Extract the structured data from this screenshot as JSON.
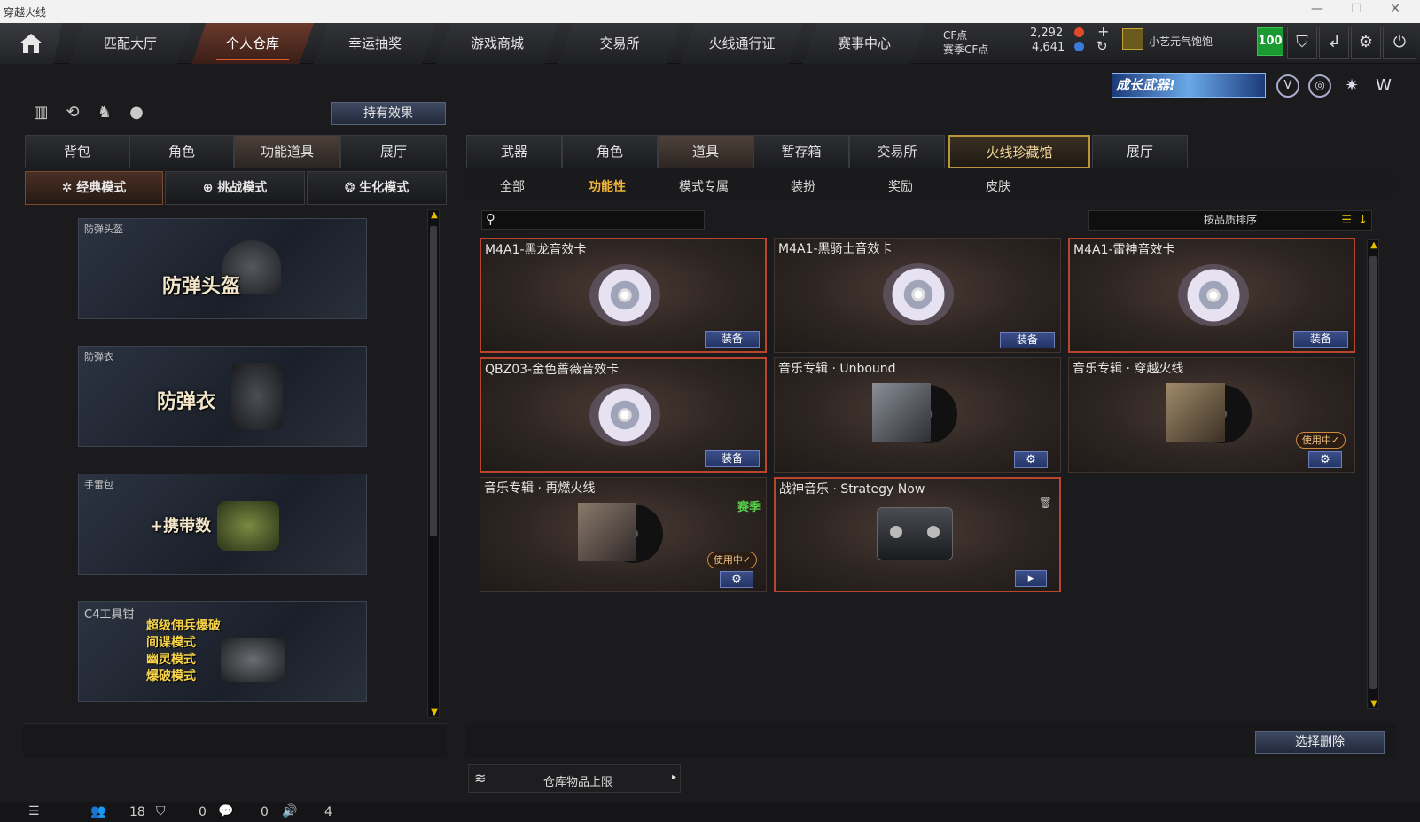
{
  "window": {
    "title": "穿越火线"
  },
  "nav": {
    "tabs": [
      "匹配大厅",
      "个人仓库",
      "幸运抽奖",
      "游戏商城",
      "交易所",
      "火线通行证",
      "赛事中心"
    ],
    "active_index": 1
  },
  "currency": {
    "cf_label": "CF点",
    "cf_value": "2,292",
    "season_label": "赛季CF点",
    "season_value": "4,641"
  },
  "user": {
    "name": "小艺元气饱饱",
    "level_badge": "100"
  },
  "banner": {
    "text": "成长武器!"
  },
  "left": {
    "hold_effect_button": "持有效果",
    "tabs": [
      "背包",
      "角色",
      "功能道具",
      "展厅"
    ],
    "active_tab": 2,
    "modes": [
      "经典模式",
      "挑战模式",
      "生化模式"
    ],
    "active_mode": 0,
    "items": [
      {
        "label": "防弹头盔",
        "text": "防弹头盔"
      },
      {
        "label": "防弹衣",
        "text": "防弹衣"
      },
      {
        "label": "手雷包",
        "text": "+携带数"
      },
      {
        "label": "C4工具钳",
        "lines": [
          "超级佣兵爆破",
          "间谍模式",
          "幽灵模式",
          "爆破模式"
        ]
      }
    ]
  },
  "right": {
    "tabs": [
      "武器",
      "角色",
      "道具",
      "暂存箱",
      "交易所",
      "火线珍藏馆",
      "展厅"
    ],
    "active_tab": 2,
    "gold_tab": 5,
    "subtabs": [
      "全部",
      "功能性",
      "模式专属",
      "装扮",
      "奖励",
      "皮肤"
    ],
    "active_subtab": 1,
    "search_placeholder": "",
    "sort_label": "按品质排序",
    "cards": [
      {
        "name": "M4A1-黑龙音效卡",
        "action": "装备",
        "type": "disc"
      },
      {
        "name": "M4A1-黑骑士音效卡",
        "action": "装备",
        "type": "disc"
      },
      {
        "name": "M4A1-雷神音效卡",
        "action": "装备",
        "type": "disc"
      },
      {
        "name": "QBZ03-金色蔷薇音效卡",
        "action": "装备",
        "type": "disc"
      },
      {
        "name": "音乐专辑 · Unbound",
        "action": "gear",
        "type": "album"
      },
      {
        "name": "音乐专辑 · 穿越火线",
        "action": "gear",
        "type": "album",
        "status": "使用中✓"
      },
      {
        "name": "音乐专辑 · 再燃火线",
        "action": "gear",
        "type": "album",
        "status": "使用中✓",
        "tag": "赛季"
      },
      {
        "name": "战神音乐 · Strategy Now",
        "action": "play",
        "type": "tape"
      }
    ],
    "delete_button": "选择删除",
    "capacity_label": "仓库物品上限"
  },
  "status": {
    "friends": "18",
    "guild": "0",
    "chat": "0",
    "volume": "4"
  }
}
